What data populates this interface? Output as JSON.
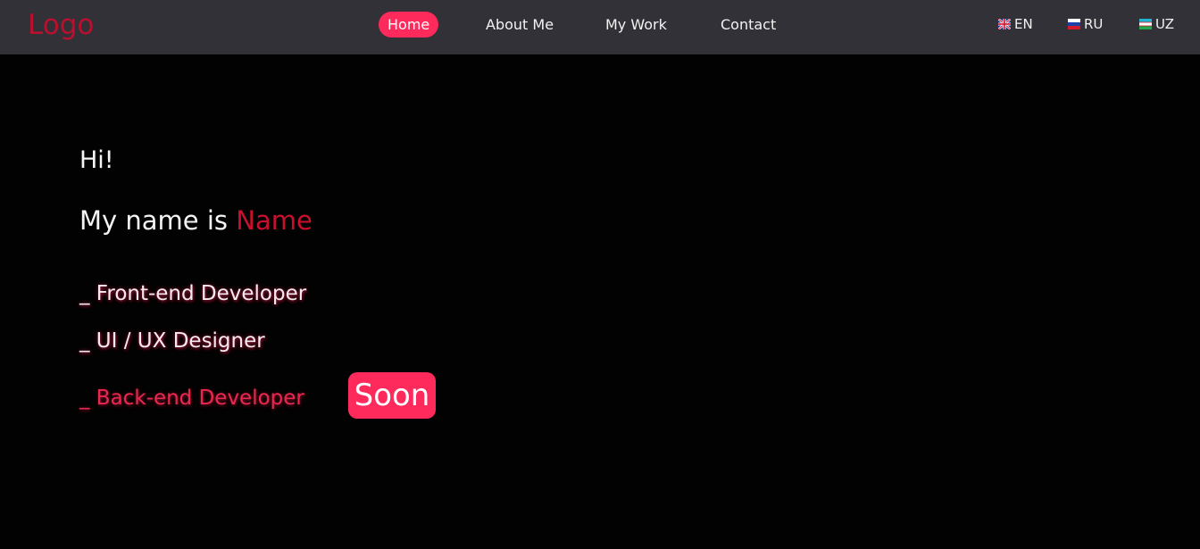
{
  "header": {
    "logo": "Logo",
    "nav": [
      {
        "label": "Home",
        "active": true
      },
      {
        "label": "About Me",
        "active": false
      },
      {
        "label": "My Work",
        "active": false
      },
      {
        "label": "Contact",
        "active": false
      }
    ],
    "languages": [
      {
        "code": "EN",
        "icon": "uk-flag-icon"
      },
      {
        "code": "RU",
        "icon": "russia-flag-icon"
      },
      {
        "code": "UZ",
        "icon": "uzbekistan-flag-icon"
      }
    ]
  },
  "hero": {
    "greeting": "Hi!",
    "name_prefix": "My name is ",
    "name": "Name",
    "roles": [
      "_ Front-end Developer",
      "_ UI / UX Designer",
      "_ Back-end Developer"
    ],
    "soon_badge": "Soon"
  },
  "colors": {
    "accent": "#ff2a5c",
    "logo": "#b8102e",
    "navbar_bg": "#323137",
    "page_bg": "#030202"
  }
}
